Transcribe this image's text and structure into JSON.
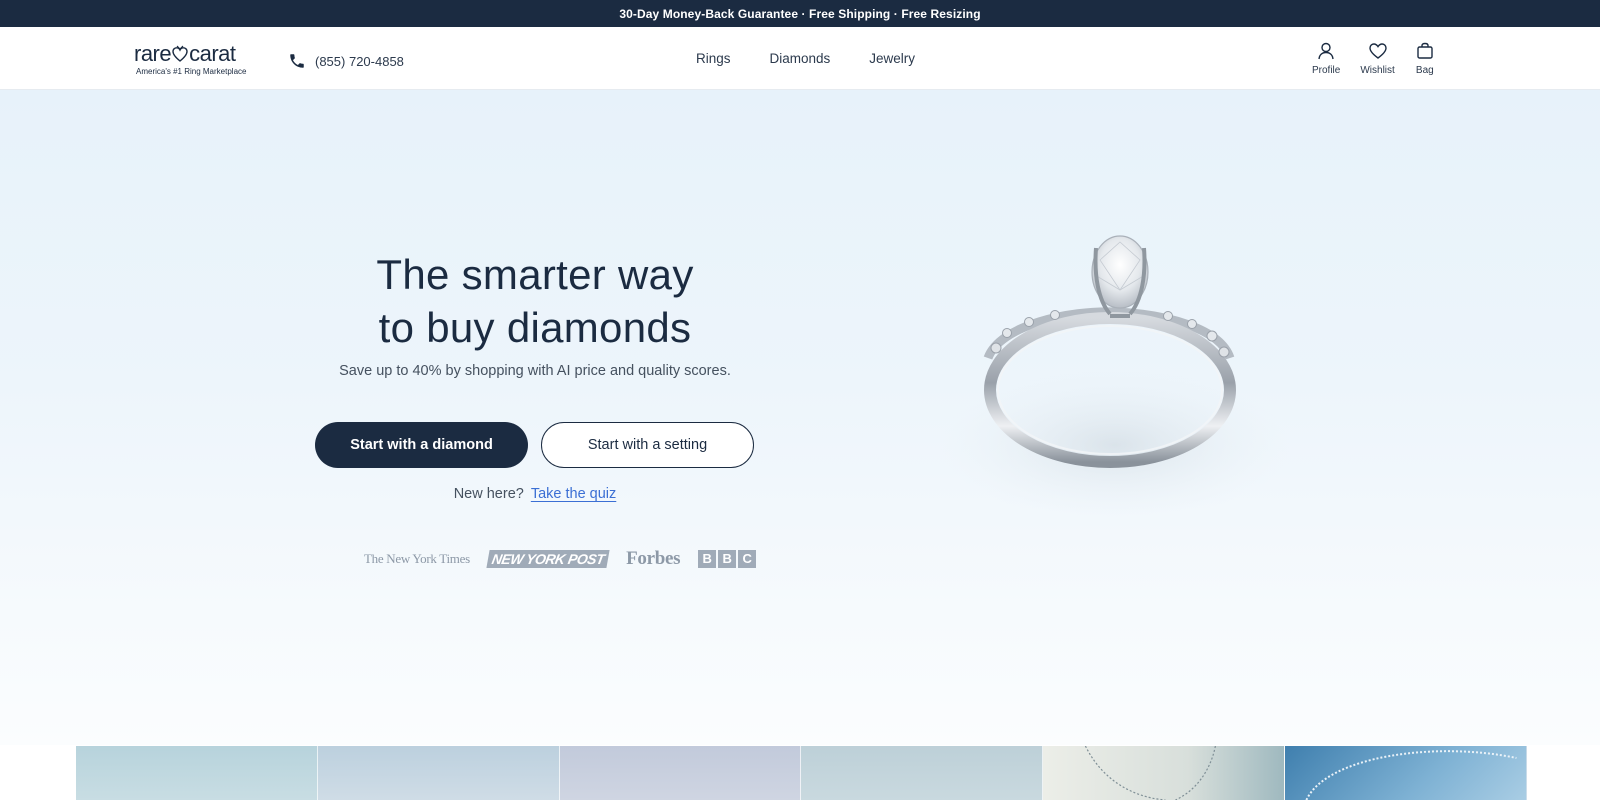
{
  "promo": {
    "text": "30-Day Money-Back Guarantee · Free Shipping · Free Resizing"
  },
  "header": {
    "logo": {
      "word_left": "rare",
      "word_right": "carat",
      "tagline": "America's #1 Ring Marketplace"
    },
    "phone": "(855) 720-4858",
    "nav": [
      "Rings",
      "Diamonds",
      "Jewelry"
    ],
    "icons": {
      "profile": "Profile",
      "wishlist": "Wishlist",
      "bag": "Bag"
    }
  },
  "hero": {
    "headline_line1": "The smarter way",
    "headline_line2": "to buy diamonds",
    "subtitle": "Save up to 40% by shopping with AI price and quality scores.",
    "primary_cta": "Start with a diamond",
    "secondary_cta": "Start with a setting",
    "quiz_prompt": "New here?",
    "quiz_link": "Take the quiz",
    "press": {
      "nyt": "The New York Times",
      "nyp": "NEW YORK POST",
      "forbes": "Forbes",
      "bbc": [
        "B",
        "B",
        "C"
      ]
    }
  },
  "colors": {
    "navy": "#1b2b41",
    "link": "#3b6fd4",
    "hero_top": "#e7f2fa"
  },
  "category_strip": {
    "tile_colors": [
      "#b7d3dc",
      "#bcd0de",
      "#c2cadb",
      "#bdd0d8",
      "#dfe4e0",
      "#6fa3c8"
    ]
  }
}
